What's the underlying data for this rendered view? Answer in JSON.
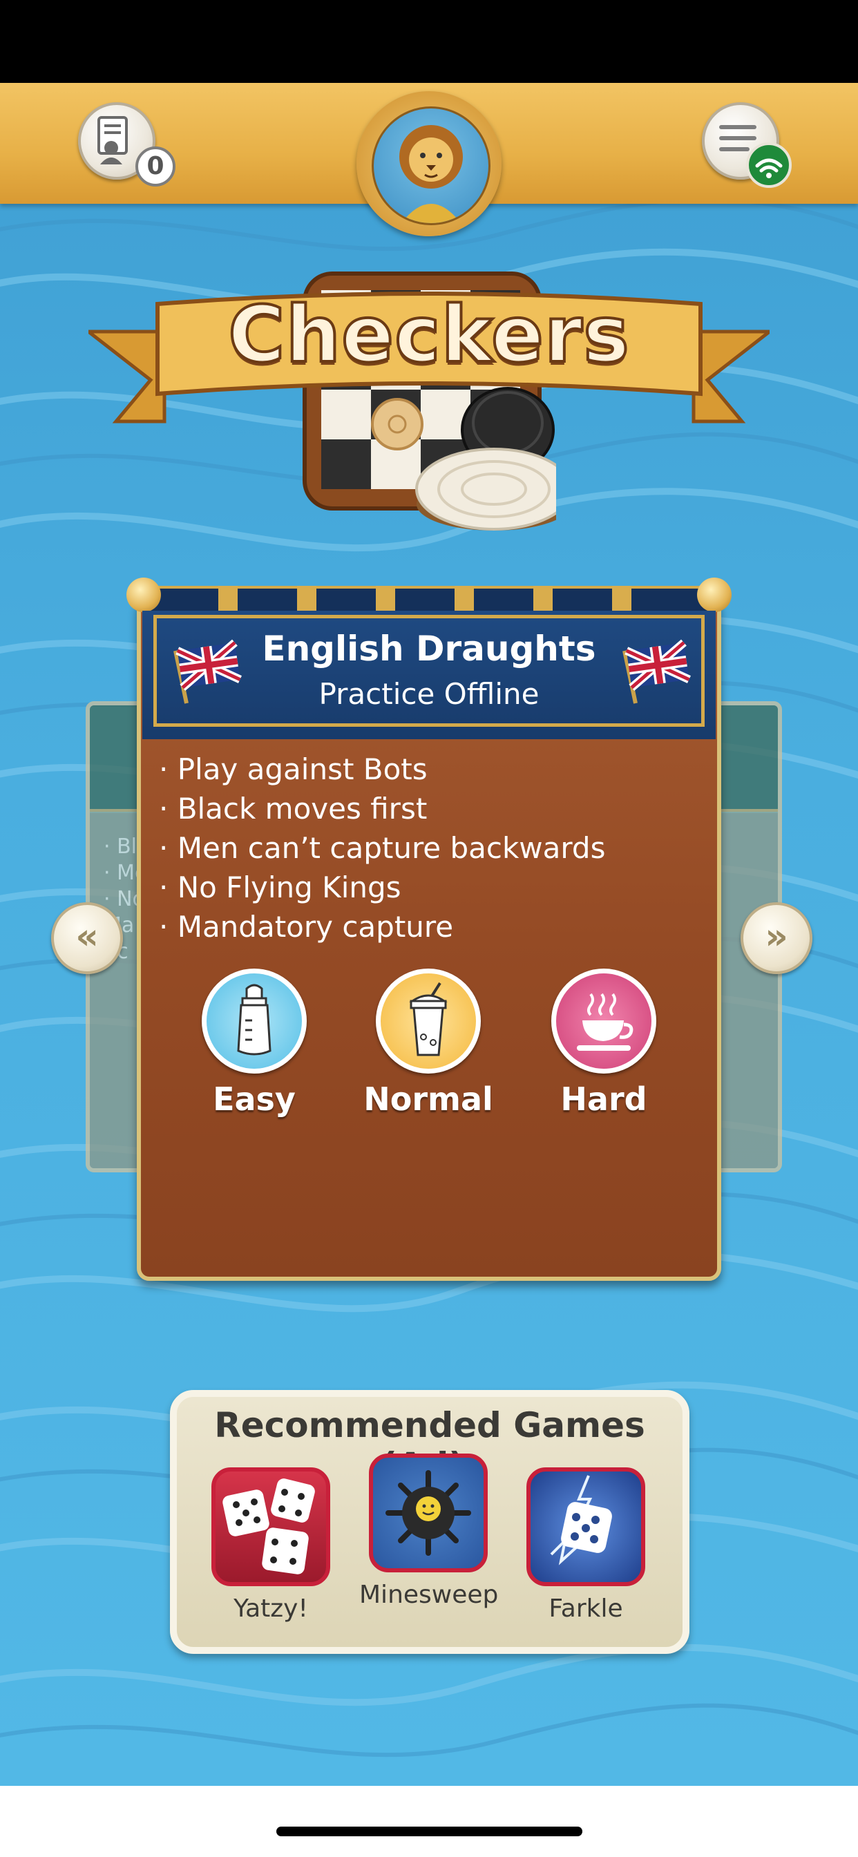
{
  "game": {
    "title": "Checkers"
  },
  "header": {
    "notification_count": "0"
  },
  "mode_card": {
    "title": "English Draughts",
    "subtitle": "Practice Offline",
    "rules": [
      "· Play against Bots",
      "· Black moves first",
      "· Men can’t capture backwards",
      "· No Flying Kings",
      "· Mandatory capture"
    ],
    "levels": [
      {
        "label": "Easy",
        "icon": "baby-bottle-icon"
      },
      {
        "label": "Normal",
        "icon": "smoothie-cup-icon"
      },
      {
        "label": "Hard",
        "icon": "hot-coffee-icon"
      }
    ]
  },
  "side_cards": {
    "left_preview_text": [
      "· Bla",
      "· Me",
      "· No",
      "Ma",
      "· c"
    ]
  },
  "navigation": {
    "prev_symbol": "«",
    "next_symbol": "»"
  },
  "recommended": {
    "title": "Recommended Games (Ad):",
    "games": [
      {
        "label": "Yatzy!",
        "icon": "dice-icon"
      },
      {
        "label": "Minesweep",
        "icon": "mine-icon"
      },
      {
        "label": "Farkle",
        "icon": "lightning-die-icon"
      }
    ]
  },
  "colors": {
    "header_gold": "#e7b047",
    "ocean_blue": "#4aaedf",
    "card_wood": "#954b25",
    "card_header_navy": "#183b6b"
  }
}
